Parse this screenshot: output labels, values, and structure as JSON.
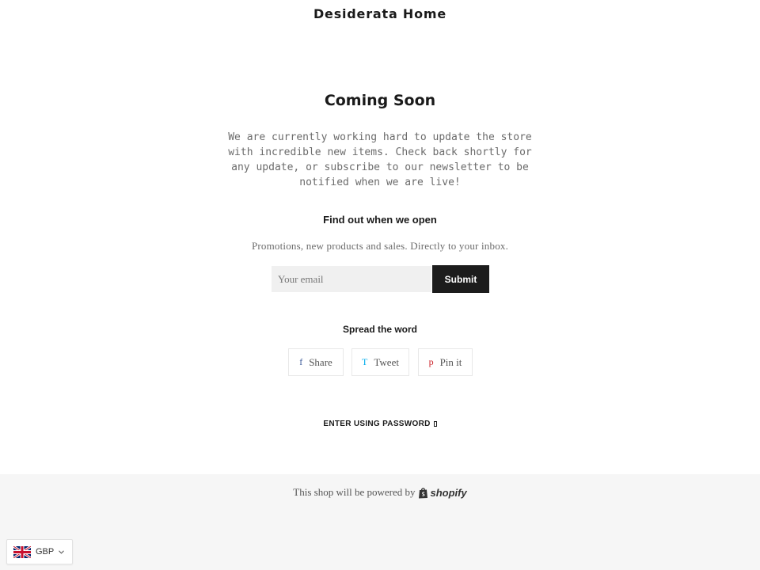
{
  "header": {
    "store_name": "Desiderata Home"
  },
  "hero": {
    "title": "Coming Soon",
    "text": "We are currently working hard to update the store with incredible new items. Check back shortly for any update, or subscribe to our newsletter to be notified when we are live!"
  },
  "signup": {
    "heading": "Find out when we open",
    "subtext": "Promotions, new products and sales. Directly to your inbox.",
    "email_placeholder": "Your email",
    "submit_label": "Submit"
  },
  "share": {
    "heading": "Spread the word",
    "buttons": [
      {
        "glyph": "f",
        "label": "Share",
        "icon": "facebook-icon",
        "color": "#3b5998"
      },
      {
        "glyph": "T",
        "label": "Tweet",
        "icon": "twitter-icon",
        "color": "#00aced"
      },
      {
        "glyph": "p",
        "label": "Pin it",
        "icon": "pinterest-icon",
        "color": "#cb2027"
      }
    ]
  },
  "password": {
    "label": "ENTER USING PASSWORD",
    "icon": "lock-icon"
  },
  "footer": {
    "powered_text": "This shop will be powered by",
    "brand": "shopify",
    "icon": "shopify-bag-icon"
  },
  "currency": {
    "code": "GBP",
    "icon": "uk-flag-icon"
  },
  "colors": {
    "button_bg": "#1c1c1c",
    "footer_bg": "#f6f6f6",
    "input_bg": "#f0f0f0"
  }
}
